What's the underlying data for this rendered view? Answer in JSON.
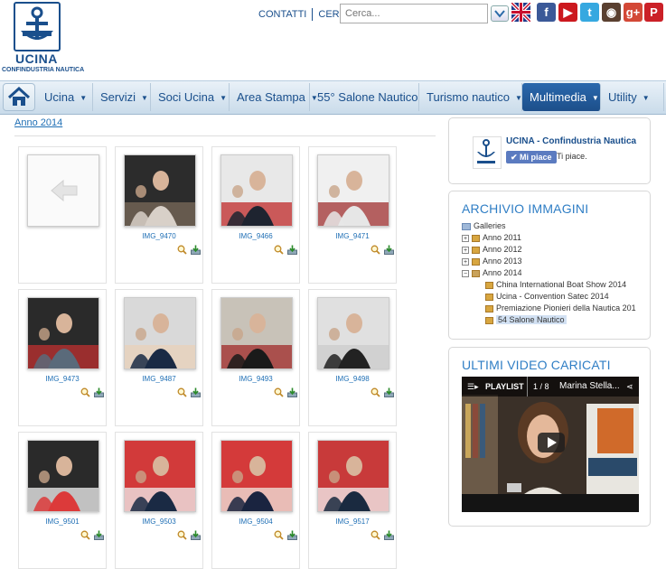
{
  "header": {
    "logo_title": "UCINA",
    "logo_subtitle": "CONFINDUSTRIA NAUTICA",
    "links": [
      "CONTATTI",
      "CERCA"
    ],
    "search_placeholder": "Cerca...",
    "social": [
      {
        "name": "uk-flag-icon",
        "color": "#1f3a8a",
        "glyph": ""
      },
      {
        "name": "facebook-icon",
        "color": "#3b5998",
        "glyph": "f"
      },
      {
        "name": "youtube-icon",
        "color": "#cc181e",
        "glyph": "▶"
      },
      {
        "name": "twitter-icon",
        "color": "#36a8e0",
        "glyph": "t"
      },
      {
        "name": "instagram-icon",
        "color": "#5a4030",
        "glyph": "◉"
      },
      {
        "name": "googleplus-icon",
        "color": "#d34836",
        "glyph": "g+"
      },
      {
        "name": "pinterest-icon",
        "color": "#cb2027",
        "glyph": "P"
      }
    ]
  },
  "nav": {
    "items": [
      {
        "label": "Ucina",
        "dropdown": true
      },
      {
        "label": "Servizi",
        "dropdown": true
      },
      {
        "label": "Soci Ucina",
        "dropdown": true
      },
      {
        "label": "Area Stampa",
        "dropdown": true
      },
      {
        "label": "55° Salone Nautico",
        "dropdown": false
      },
      {
        "label": "Turismo nautico",
        "dropdown": true
      },
      {
        "label": "Multimedia",
        "dropdown": true,
        "active": true
      },
      {
        "label": "Utility",
        "dropdown": true
      }
    ]
  },
  "breadcrumb": "Anno 2014",
  "gallery": {
    "items": [
      {
        "caption": "",
        "back": true
      },
      {
        "caption": "IMG_9470"
      },
      {
        "caption": "IMG_9466"
      },
      {
        "caption": "IMG_9471"
      },
      {
        "caption": "IMG_9473"
      },
      {
        "caption": "IMG_9487"
      },
      {
        "caption": "IMG_9493"
      },
      {
        "caption": "IMG_9498"
      },
      {
        "caption": "IMG_9501"
      },
      {
        "caption": "IMG_9503"
      },
      {
        "caption": "IMG_9504"
      },
      {
        "caption": "IMG_9517"
      }
    ]
  },
  "fb_panel": {
    "page_name": "UCINA - Confindustria Nautica",
    "like_label": "Mi piace",
    "like_text": "Ti piace."
  },
  "archive": {
    "title": "ARCHIVIO IMMAGINI",
    "root": "Galleries",
    "years": [
      "Anno 2011",
      "Anno 2012",
      "Anno 2013",
      "Anno 2014"
    ],
    "children": [
      "China International Boat Show 2014",
      "Ucina - Convention Satec 2014",
      "Premiazione Pionieri della Nautica 201",
      "54 Salone Nautico"
    ]
  },
  "videos": {
    "title": "ULTIMI VIDEO CARICATI",
    "playlist_label": "PLAYLIST",
    "playlist_count": "1 / 8",
    "video_title": "Marina Stella..."
  }
}
